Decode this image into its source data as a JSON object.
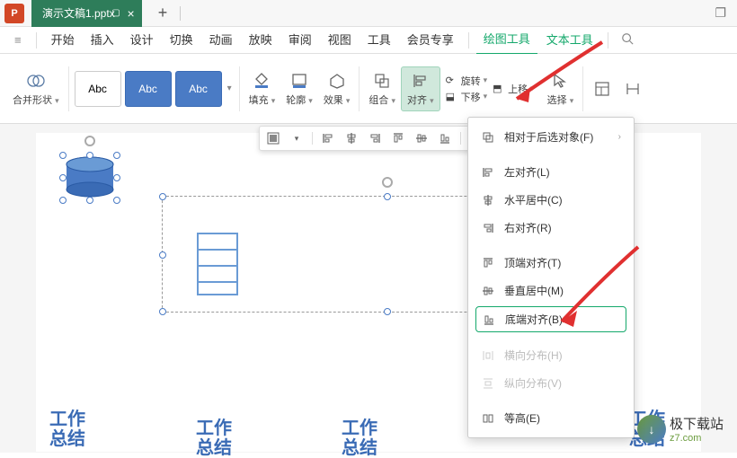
{
  "title_bar": {
    "app_letter": "P",
    "doc_name": "演示文稿1.pptx",
    "add_tab": "+"
  },
  "menu": {
    "items": [
      "开始",
      "插入",
      "设计",
      "切换",
      "动画",
      "放映",
      "审阅",
      "视图",
      "工具",
      "会员专享"
    ],
    "active1": "绘图工具",
    "active2": "文本工具"
  },
  "ribbon": {
    "merge_shape": "合并形状",
    "abc": "Abc",
    "fill": "填充",
    "outline": "轮廓",
    "effect": "效果",
    "group": "组合",
    "align": "对齐",
    "rotate": "旋转",
    "move_up": "上移",
    "move_down": "下移",
    "select": "选择"
  },
  "dropdown": {
    "relative": "相对于后选对象(F)",
    "left": "左对齐(L)",
    "center_h": "水平居中(C)",
    "right": "右对齐(R)",
    "top": "顶端对齐(T)",
    "center_v": "垂直居中(M)",
    "bottom": "底端对齐(B)",
    "dist_h": "横向分布(H)",
    "dist_v": "纵向分布(V)",
    "equal_h": "等高(E)"
  },
  "slide_text": {
    "t1": "工作\n总结",
    "t2": "工作\n总结",
    "t3": "工作\n总结",
    "t4": "工作\n总结"
  },
  "watermark": {
    "main": "极下载站",
    "sub": "z7.com"
  }
}
